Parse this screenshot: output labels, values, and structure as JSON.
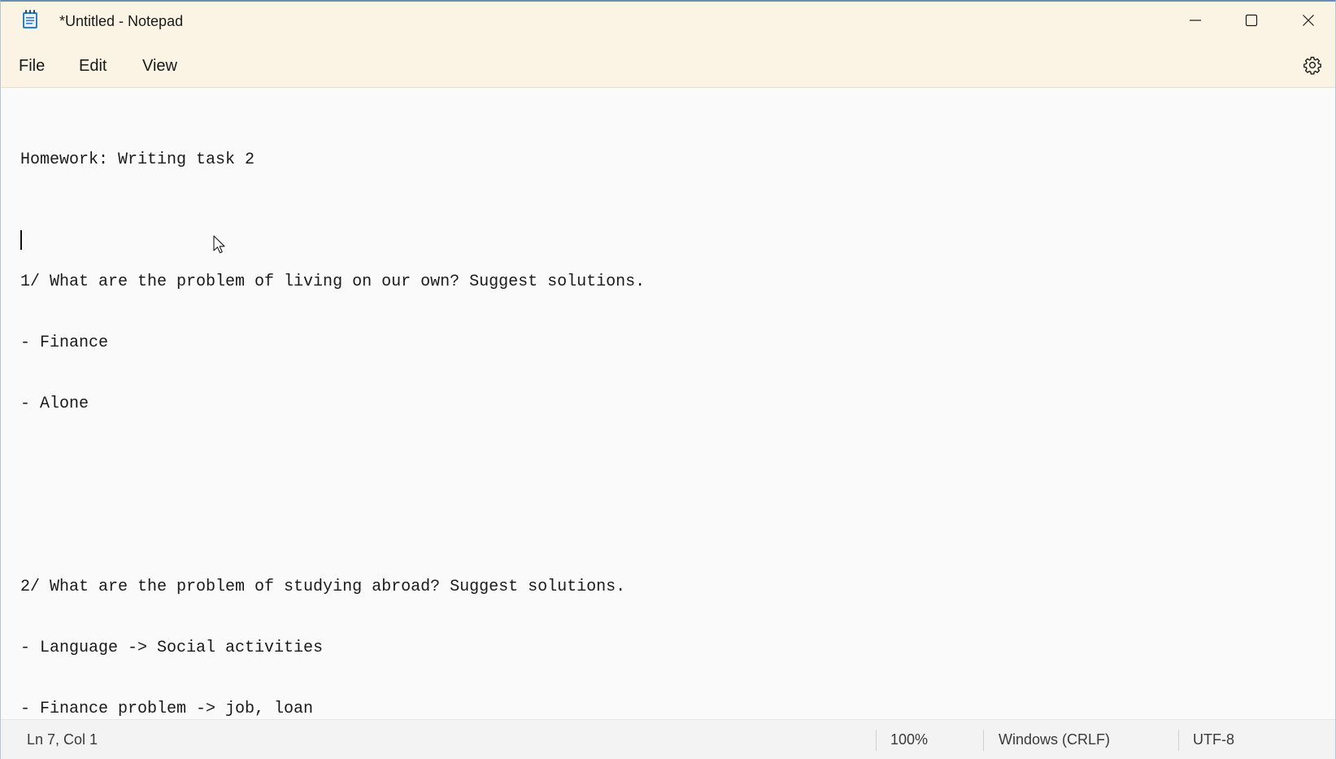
{
  "window": {
    "title": "*Untitled - Notepad",
    "icon": "notepad-icon"
  },
  "title_buttons": {
    "minimize_icon": "minimize-icon",
    "maximize_icon": "maximize-icon",
    "close_icon": "close-icon"
  },
  "menu": {
    "file": "File",
    "edit": "Edit",
    "view": "View",
    "settings_icon": "gear-icon"
  },
  "editor": {
    "lines": [
      "Homework: Writing task 2",
      "",
      "1/ What are the problem of living on our own? Suggest solutions.",
      "- Finance",
      "- Alone",
      "",
      "",
      "2/ What are the problem of studying abroad? Suggest solutions.",
      "- Language -> Social activities",
      "- Finance problem -> job, loan"
    ]
  },
  "status": {
    "position": "Ln 7, Col 1",
    "zoom": "100%",
    "line_ending": "Windows (CRLF)",
    "encoding": "UTF-8"
  },
  "colors": {
    "chrome_bg": "#fbf4e5",
    "editor_bg": "#fafafa",
    "status_bg": "#f3f3f3",
    "icon_blue": "#2f7fc4"
  }
}
